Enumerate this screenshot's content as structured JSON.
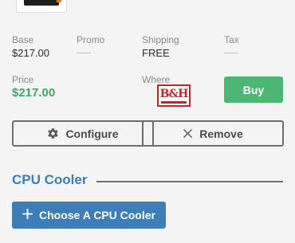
{
  "product": {
    "thumbnail_icon": "power-supply-product-image"
  },
  "pricing": {
    "base_label": "Base",
    "base_value": "$217.00",
    "promo_label": "Promo",
    "promo_value": "",
    "shipping_label": "Shipping",
    "shipping_value": "FREE",
    "tax_label": "Tax",
    "tax_value": "",
    "price_label": "Price",
    "price_value": "$217.00",
    "where_label": "Where",
    "retailer_logo_text": "B&H",
    "retailer_logo_icon": "bh-photo-logo"
  },
  "actions": {
    "buy_label": "Buy",
    "configure_label": "Configure",
    "configure_icon": "gear-icon",
    "remove_label": "Remove",
    "remove_icon": "close-icon"
  },
  "section": {
    "title": "CPU Cooler",
    "choose_label": "Choose A CPU Cooler",
    "choose_icon": "plus-icon"
  },
  "colors": {
    "price_green": "#3fa66a",
    "buy_green": "#4db675",
    "accent_blue": "#3d7db8",
    "retailer_red": "#c2262b"
  }
}
